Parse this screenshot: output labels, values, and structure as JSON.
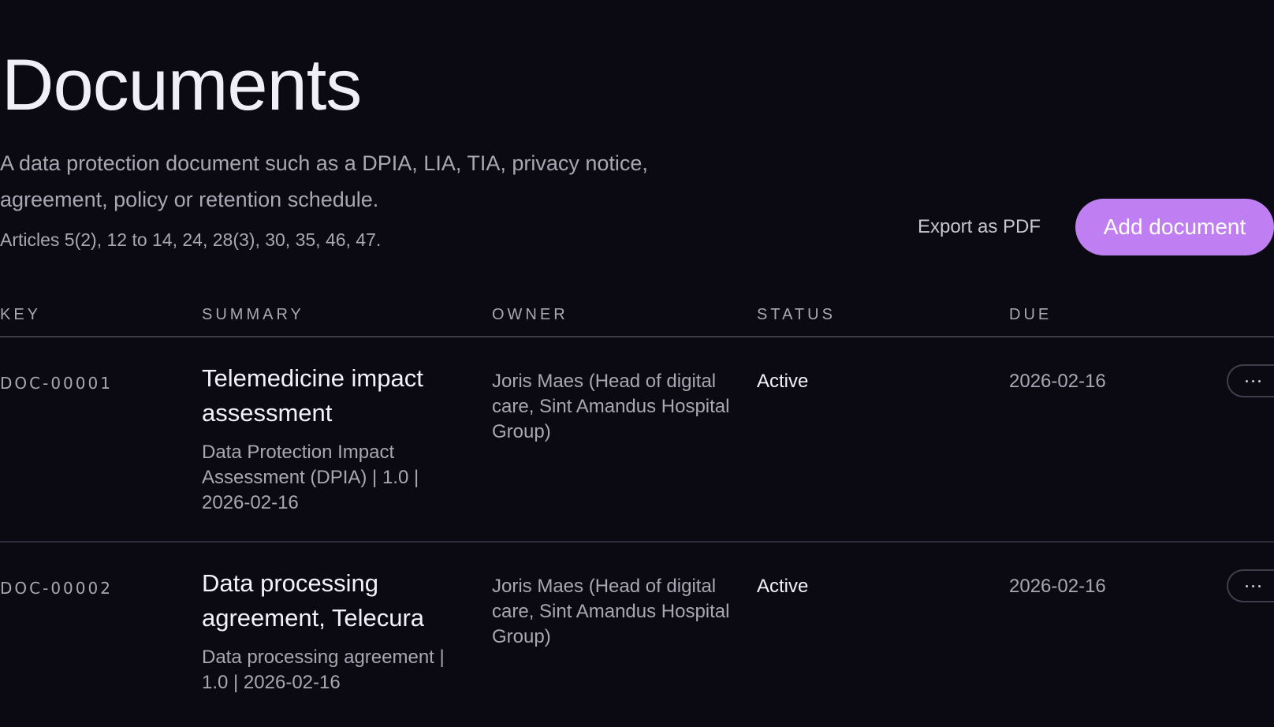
{
  "header": {
    "title": "Documents",
    "description": "A data protection document such as a DPIA, LIA, TIA, privacy notice, agreement, policy or retention schedule.",
    "articles": "Articles 5(2), 12 to 14, 24, 28(3), 30, 35, 46, 47."
  },
  "actions": {
    "export_label": "Export as PDF",
    "add_label": "Add document",
    "add_color": "#bf7ff2"
  },
  "table": {
    "columns": {
      "key": "KEY",
      "summary": "SUMMARY",
      "owner": "OWNER",
      "status": "STATUS",
      "due": "DUE"
    },
    "rows": [
      {
        "key": "DOC-00001",
        "title": "Telemedicine impact assessment",
        "meta": "Data Protection Impact Assessment (DPIA) | 1.0 | 2026-02-16",
        "owner": "Joris Maes (Head of digital care, Sint Amandus Hospital Group)",
        "status": "Active",
        "due": "2026-02-16",
        "menu_icon": "more-horizontal-icon"
      },
      {
        "key": "DOC-00002",
        "title": "Data processing agreement, Telecura",
        "meta": "Data processing agreement | 1.0 | 2026-02-16",
        "owner": "Joris Maes (Head of digital care, Sint Amandus Hospital Group)",
        "status": "Active",
        "due": "2026-02-16",
        "menu_icon": "more-horizontal-icon"
      }
    ]
  }
}
